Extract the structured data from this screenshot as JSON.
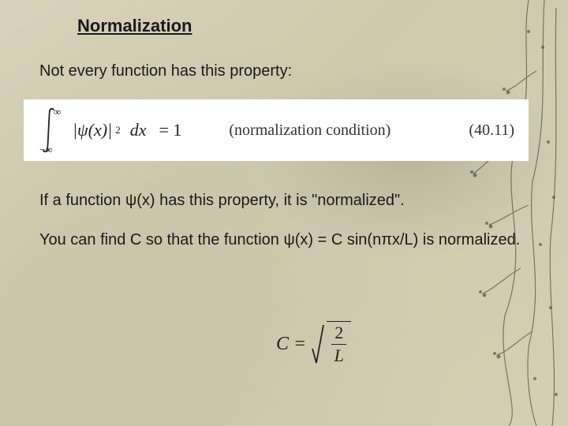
{
  "title": "Normalization",
  "line1": "Not every function has this property:",
  "equation": {
    "upper_limit": "∞",
    "lower_limit": "−∞",
    "integrand": "|ψ(x)|",
    "exponent": "2",
    "diff": "dx",
    "equals": "= 1",
    "condition": "(normalization condition)",
    "number": "(40.11)"
  },
  "line2": "If a function ψ(x) has this property, it is \"normalized\".",
  "line3": "You can find C so that the function ψ(x) = C sin(nπx/L) is normalized.",
  "constant": {
    "lhs": "C =",
    "num": "2",
    "den": "L"
  }
}
